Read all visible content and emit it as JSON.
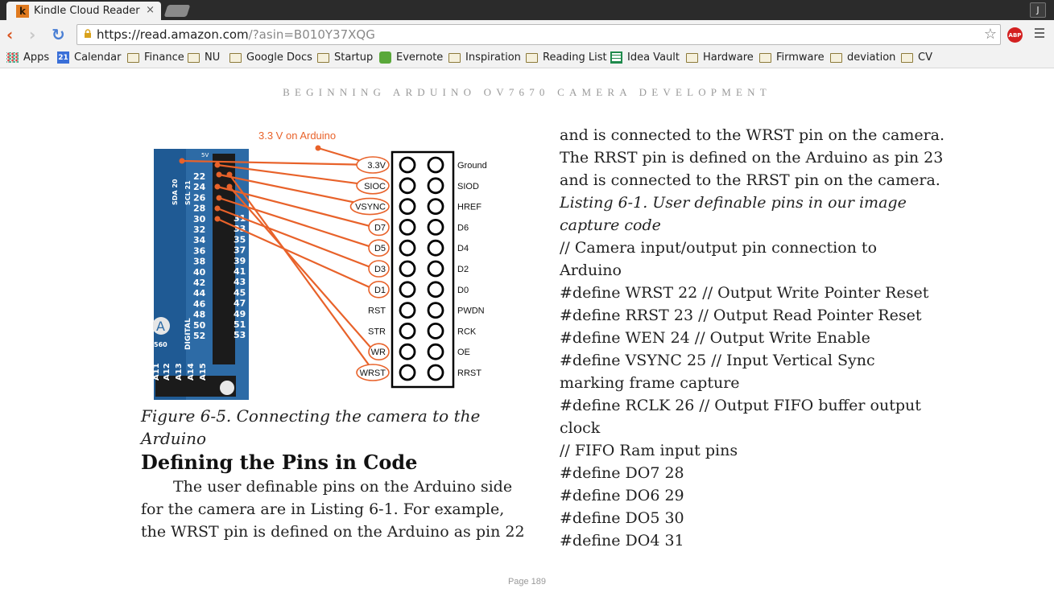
{
  "browser": {
    "tab_title": "Kindle Cloud Reader",
    "tab_close": "×",
    "favicon_letter": "k",
    "profile_initial": "J",
    "url_main": "https://read.amazon.com",
    "url_query": "/?asin=B010Y37XQG",
    "abp_label": "ABP",
    "back_glyph": "‹",
    "forward_glyph": "›",
    "reload_glyph": "↻",
    "star_glyph": "☆"
  },
  "bookmarks": [
    {
      "label": "Apps",
      "icon": "apps-icon"
    },
    {
      "label": "Calendar",
      "icon": "calendar-icon",
      "badge": "21"
    },
    {
      "label": "Finance",
      "icon": "folder-icon"
    },
    {
      "label": "NU",
      "icon": "folder-icon"
    },
    {
      "label": "Google Docs",
      "icon": "folder-icon"
    },
    {
      "label": "Startup",
      "icon": "folder-icon"
    },
    {
      "label": "Evernote",
      "icon": "evernote-icon"
    },
    {
      "label": "Inspiration",
      "icon": "folder-icon"
    },
    {
      "label": "Reading List",
      "icon": "folder-icon"
    },
    {
      "label": "Idea Vault",
      "icon": "spreadsheet-icon"
    },
    {
      "label": "Hardware",
      "icon": "folder-icon"
    },
    {
      "label": "Firmware",
      "icon": "folder-icon"
    },
    {
      "label": "deviation",
      "icon": "folder-icon"
    },
    {
      "label": "CV",
      "icon": "folder-icon"
    }
  ],
  "book": {
    "running_title": "BEGINNING ARDUINO OV7670 CAMERA DEVELOPMENT",
    "page_label": "Page 189"
  },
  "figure": {
    "supply_label": "3.3 V on Arduino",
    "arduino_pins": [
      "22",
      "24",
      "26",
      "28",
      "30",
      "32",
      "34",
      "36",
      "38",
      "40",
      "42",
      "44",
      "46",
      "48",
      "50",
      "52"
    ],
    "arduino_pins_right": [
      "31",
      "33",
      "35",
      "37",
      "39",
      "41",
      "43",
      "45",
      "47",
      "49",
      "51",
      "53"
    ],
    "left_signals": [
      "3.3V",
      "SIOC",
      "VSYNC",
      "D7",
      "D5",
      "D3",
      "D1",
      "RST",
      "STR",
      "WR",
      "WRST"
    ],
    "right_signals": [
      "Ground",
      "SIOD",
      "HREF",
      "D6",
      "D4",
      "D2",
      "D0",
      "PWDN",
      "RCK",
      "OE",
      "RRST"
    ],
    "board_labels": [
      "SDA 20",
      "SCL 21",
      "DIGITAL",
      "5V",
      "A12",
      "A13",
      "A14",
      "A15",
      "A11",
      "560"
    ],
    "colors": {
      "wire": "#e8622a",
      "board": "#2d6ba6"
    }
  },
  "left_column": {
    "caption_lines": [
      "Figure 6-5. Connecting the camera to the",
      "Arduino"
    ],
    "heading": "Defining the Pins in Code",
    "paragraph_lines": [
      "The user definable pins on the Arduino side",
      "for the camera are in Listing 6-1. For example,",
      "the WRST pin is defined on the Arduino as pin 22"
    ]
  },
  "right_column": {
    "lines": [
      "and is connected to the WRST pin on the camera.",
      "The RRST pin is defined on the Arduino as pin 23",
      "and is connected to the RRST pin on the camera.",
      "Listing 6-1. User definable pins in our image",
      "capture code",
      "// Camera input/output pin connection to",
      "Arduino",
      "#define WRST 22 // Output Write Pointer Reset",
      "#define RRST 23 // Output Read Pointer Reset",
      "#define WEN 24 // Output Write Enable",
      "#define VSYNC 25 // Input Vertical Sync",
      "marking frame capture",
      "#define RCLK 26 // Output FIFO buffer output",
      "clock",
      "// FIFO Ram input pins",
      "#define DO7 28",
      "#define DO6 29",
      "#define DO5 30",
      "#define DO4 31"
    ],
    "italic_line_indices": [
      3,
      4
    ]
  }
}
